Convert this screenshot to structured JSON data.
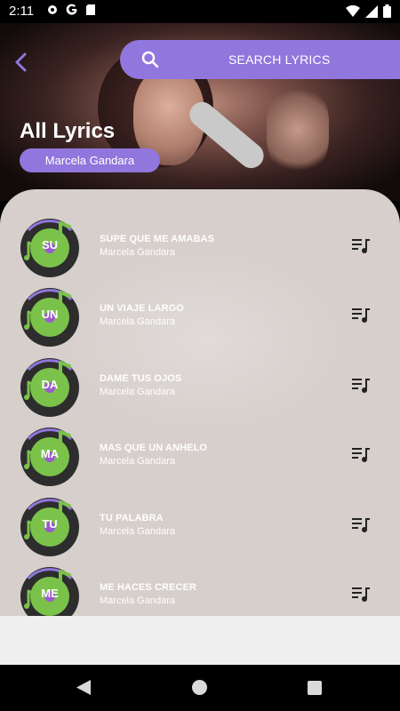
{
  "status_bar": {
    "time": "2:11",
    "icons_left": [
      "gear-icon",
      "google-icon",
      "sd-card-icon"
    ],
    "icons_right": [
      "wifi-icon",
      "signal-icon",
      "battery-icon"
    ]
  },
  "header": {
    "search_label": "SEARCH LYRICS",
    "title": "All Lyrics",
    "artist_chip": "Marcela Gandara"
  },
  "colors": {
    "accent": "#9176dd",
    "panel": "#d6cfcc",
    "disc_green": "#7bc24a",
    "disc_dark": "#2d2d2d"
  },
  "songs": [
    {
      "abbr": "SU",
      "title": "SUPE QUE ME AMABAS",
      "artist": "Marcela Gandara"
    },
    {
      "abbr": "UN",
      "title": "UN VIAJE LARGO",
      "artist": "Marcela Gandara"
    },
    {
      "abbr": "DA",
      "title": "DAME TUS OJOS",
      "artist": "Marcela Gandara"
    },
    {
      "abbr": "MA",
      "title": "MAS QUE UN ANHELO",
      "artist": "Marcela Gandara"
    },
    {
      "abbr": "TU",
      "title": "TU PALABRA",
      "artist": "Marcela Gandara"
    },
    {
      "abbr": "ME",
      "title": "ME HACES CRECER",
      "artist": "Marcela Gandara"
    }
  ]
}
